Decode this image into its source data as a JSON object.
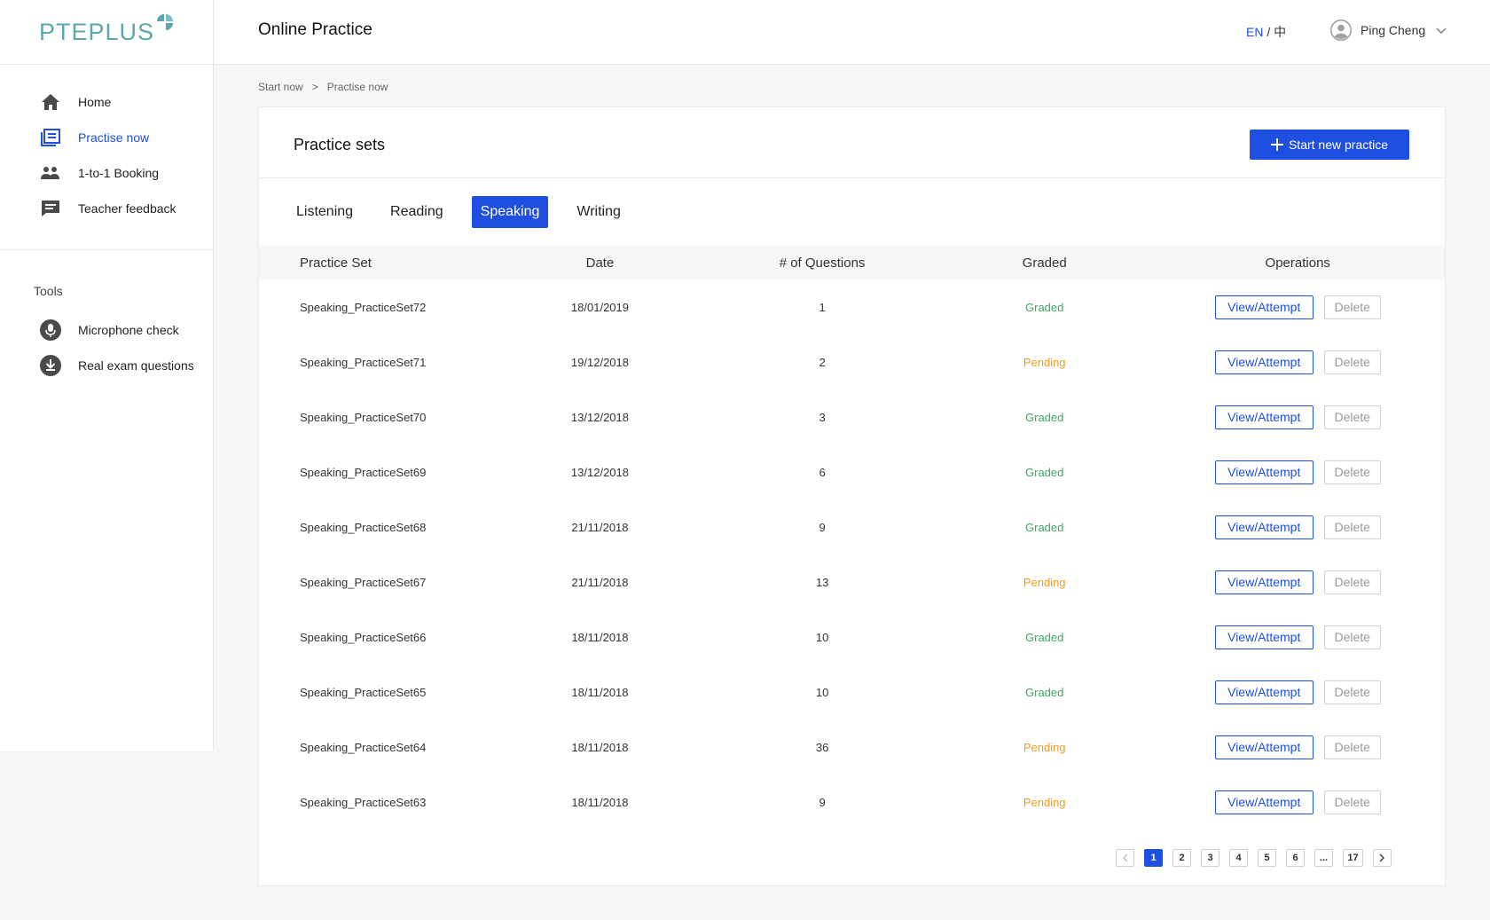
{
  "brand": {
    "logo_text": "PTEPLUS",
    "accent": "#1e4fe0",
    "logo_color": "#5aa8ad"
  },
  "header": {
    "title": "Online Practice",
    "lang_en": "EN",
    "lang_sep": " / ",
    "lang_zh": "中",
    "user_name": "Ping Cheng"
  },
  "sidebar": {
    "items": [
      {
        "label": "Home",
        "icon": "home-icon"
      },
      {
        "label": "Practise now",
        "icon": "list-icon",
        "active": true
      },
      {
        "label": "1-to-1 Booking",
        "icon": "people-icon"
      },
      {
        "label": "Teacher feedback",
        "icon": "chat-icon"
      }
    ],
    "tools_title": "Tools",
    "tools": [
      {
        "label": "Microphone check",
        "icon": "microphone-icon"
      },
      {
        "label": "Real exam questions",
        "icon": "download-icon"
      }
    ]
  },
  "breadcrumb": {
    "first": "Start now",
    "separator": ">",
    "second": "Practise now"
  },
  "card": {
    "title": "Practice sets",
    "start_button": "Start new practice"
  },
  "tabs": [
    "Listening",
    "Reading",
    "Speaking",
    "Writing"
  ],
  "active_tab": "Speaking",
  "table": {
    "headers": [
      "Practice Set",
      "Date",
      "# of Questions",
      "Graded",
      "Operations"
    ],
    "view_label": "View/Attempt",
    "delete_label": "Delete",
    "rows": [
      {
        "name": "Speaking_PracticeSet72",
        "date": "18/01/2019",
        "questions": "1",
        "status": "Graded"
      },
      {
        "name": "Speaking_PracticeSet71",
        "date": "19/12/2018",
        "questions": "2",
        "status": "Pending"
      },
      {
        "name": "Speaking_PracticeSet70",
        "date": "13/12/2018",
        "questions": "3",
        "status": "Graded"
      },
      {
        "name": "Speaking_PracticeSet69",
        "date": "13/12/2018",
        "questions": "6",
        "status": "Graded"
      },
      {
        "name": "Speaking_PracticeSet68",
        "date": "21/11/2018",
        "questions": "9",
        "status": "Graded"
      },
      {
        "name": "Speaking_PracticeSet67",
        "date": "21/11/2018",
        "questions": "13",
        "status": "Pending"
      },
      {
        "name": "Speaking_PracticeSet66",
        "date": "18/11/2018",
        "questions": "10",
        "status": "Graded"
      },
      {
        "name": "Speaking_PracticeSet65",
        "date": "18/11/2018",
        "questions": "10",
        "status": "Graded"
      },
      {
        "name": "Speaking_PracticeSet64",
        "date": "18/11/2018",
        "questions": "36",
        "status": "Pending"
      },
      {
        "name": "Speaking_PracticeSet63",
        "date": "18/11/2018",
        "questions": "9",
        "status": "Pending"
      }
    ]
  },
  "pagination": {
    "pages": [
      "1",
      "2",
      "3",
      "4",
      "5",
      "6",
      "...",
      "17"
    ],
    "current": "1"
  },
  "status_colors": {
    "Graded": "#3ea863",
    "Pending": "#f29a1c"
  }
}
